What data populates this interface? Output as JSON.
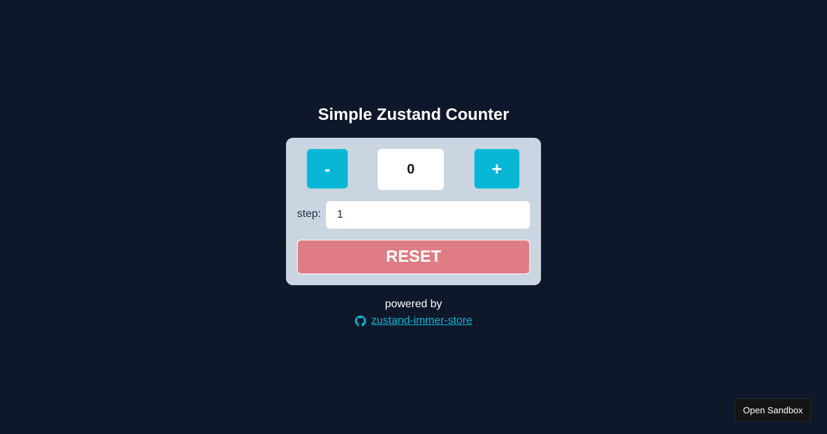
{
  "title": "Simple Zustand Counter",
  "counter": {
    "decrement_label": "-",
    "increment_label": "+",
    "value": "0"
  },
  "step": {
    "label": "step:",
    "value": "1"
  },
  "reset": {
    "label": "RESET"
  },
  "footer": {
    "powered_by": "powered by",
    "repo_icon": "github-icon",
    "repo_name": "zustand-immer-store"
  },
  "sandbox": {
    "label": "Open Sandbox"
  },
  "colors": {
    "background": "#0f172a",
    "card": "#cbd5e1",
    "accent": "#06b6d4",
    "reset": "#e07d84"
  }
}
